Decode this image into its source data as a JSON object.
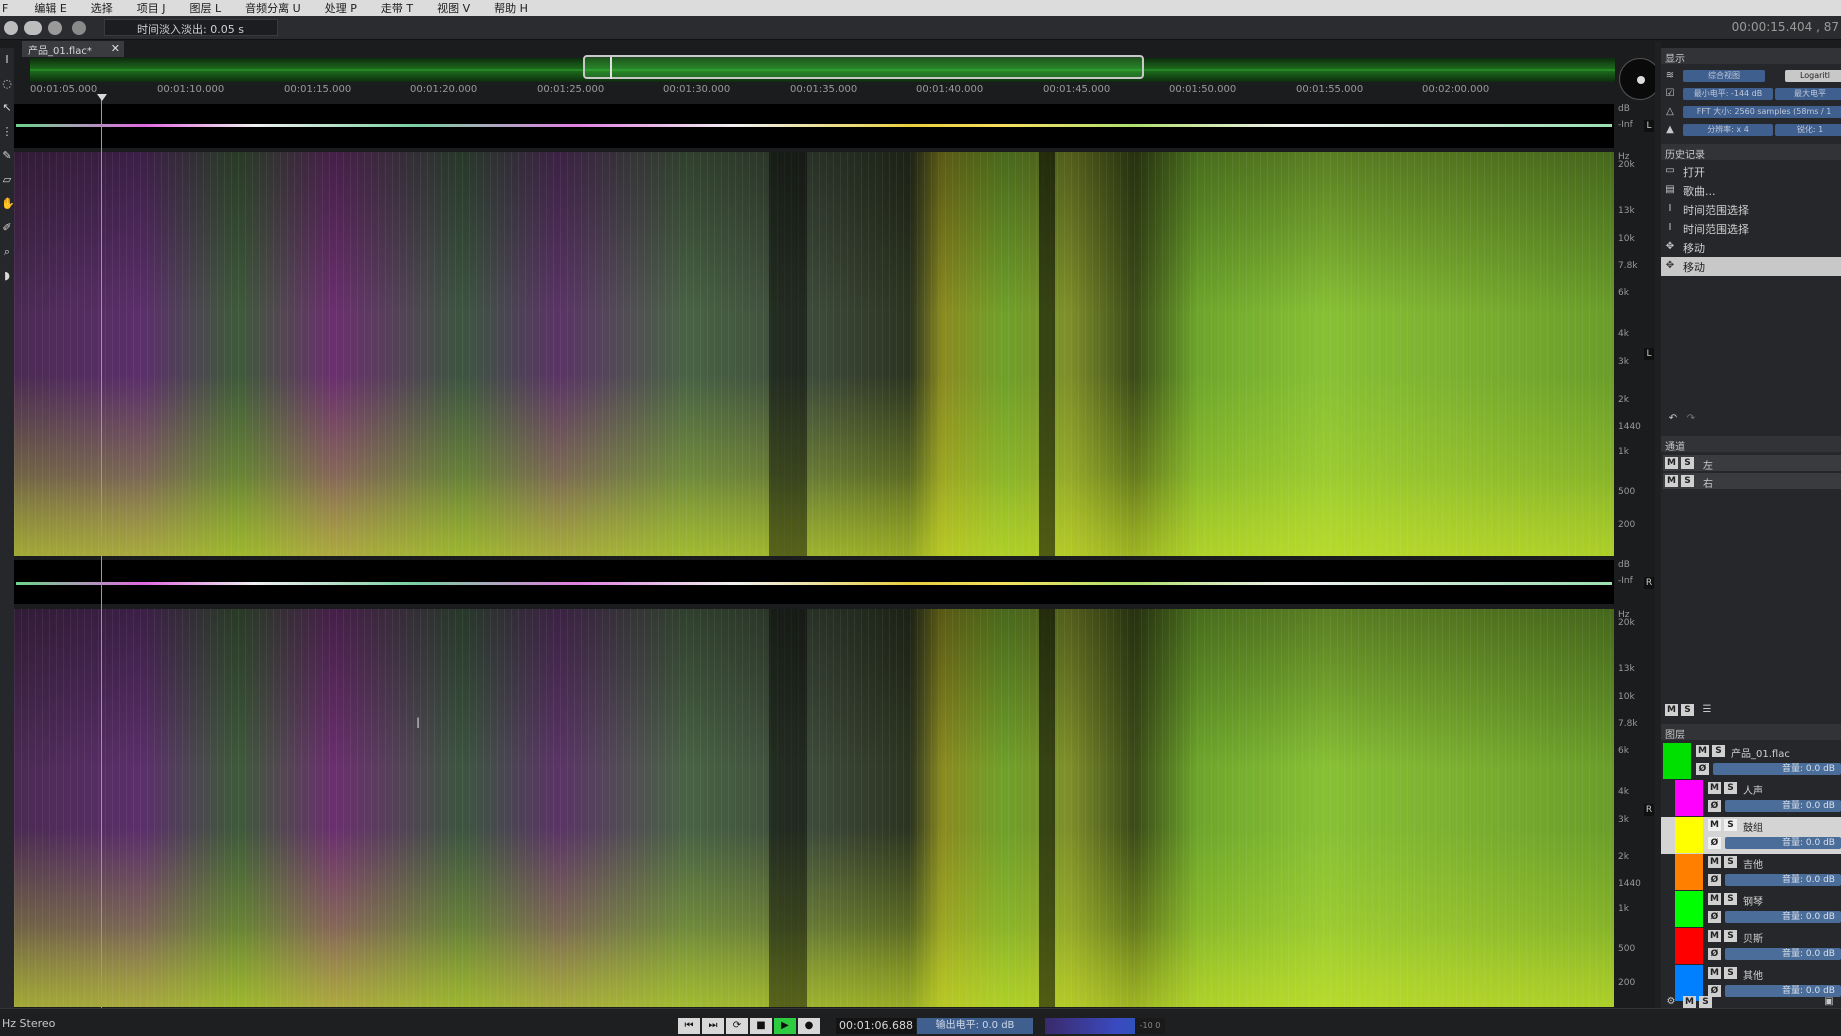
{
  "menu": [
    "F",
    "编辑 E",
    "选择",
    "项目 J",
    "图层 L",
    "音频分离 U",
    "处理 P",
    "走带 T",
    "视图 V",
    "帮助 H"
  ],
  "toolbar": {
    "fade_label": "时间淡入淡出:  0.05 s",
    "timecode": "00:00:15.404 , 87"
  },
  "file_tab": {
    "name": "产品_01.flac*",
    "close": "✕"
  },
  "ruler_ticks": [
    "00:01:05.000",
    "00:01:10.000",
    "00:01:15.000",
    "00:01:20.000",
    "00:01:25.000",
    "00:01:30.000",
    "00:01:35.000",
    "00:01:40.000",
    "00:01:45.000",
    "00:01:50.000",
    "00:01:55.000",
    "00:02:00.000"
  ],
  "freq_labels": [
    "20k",
    "13k",
    "10k",
    "7.8k",
    "6k",
    "4k",
    "3k",
    "2k",
    "1440",
    "1k",
    "500",
    "200"
  ],
  "wave_labels": {
    "db": "dB",
    "inf": "-Inf",
    "hz": "Hz",
    "left": "L",
    "right": "R"
  },
  "panel": {
    "display": {
      "title": "显示",
      "mode": "综合视图",
      "scale": "Logaritl",
      "min_level": "最小电平: -144 dB",
      "max_level": "最大电平",
      "fft": "FFT 大小: 2560 samples (58ms / 1",
      "ratio": "分辨率: x 4",
      "sharpen": "锐化: 1"
    },
    "history": {
      "title": "历史记录",
      "items": [
        "打开",
        "歌曲...",
        "时间范围选择",
        "时间范围选择",
        "移动",
        "移动"
      ],
      "icons": [
        "folder-icon",
        "document-icon",
        "ibeam-icon",
        "ibeam-icon",
        "move-icon",
        "move-icon"
      ]
    },
    "channels": {
      "title": "通道",
      "items": [
        "左",
        "右"
      ]
    },
    "layers": {
      "title": "图层",
      "master": {
        "name": "产品_01.flac",
        "volume": "音量: 0.0 dB",
        "color": "#00e000"
      },
      "items": [
        {
          "name": "人声",
          "volume": "音量: 0.0 dB",
          "color": "#ff00ff"
        },
        {
          "name": "鼓组",
          "volume": "音量: 0.0 dB",
          "color": "#ffff00"
        },
        {
          "name": "吉他",
          "volume": "音量: 0.0 dB",
          "color": "#ff8000"
        },
        {
          "name": "钢琴",
          "volume": "音量: 0.0 dB",
          "color": "#00ff00"
        },
        {
          "name": "贝斯",
          "volume": "音量: 0.0 dB",
          "color": "#ff0000"
        },
        {
          "name": "其他",
          "volume": "音量: 0.0 dB",
          "color": "#0080ff"
        }
      ]
    },
    "ms": {
      "m": "M",
      "s": "S"
    }
  },
  "status": {
    "left": "Hz Stereo",
    "timecode": "00:01:06.688",
    "output_level": "输出电平:  0.0 dB",
    "meter_end": "-10 0"
  }
}
